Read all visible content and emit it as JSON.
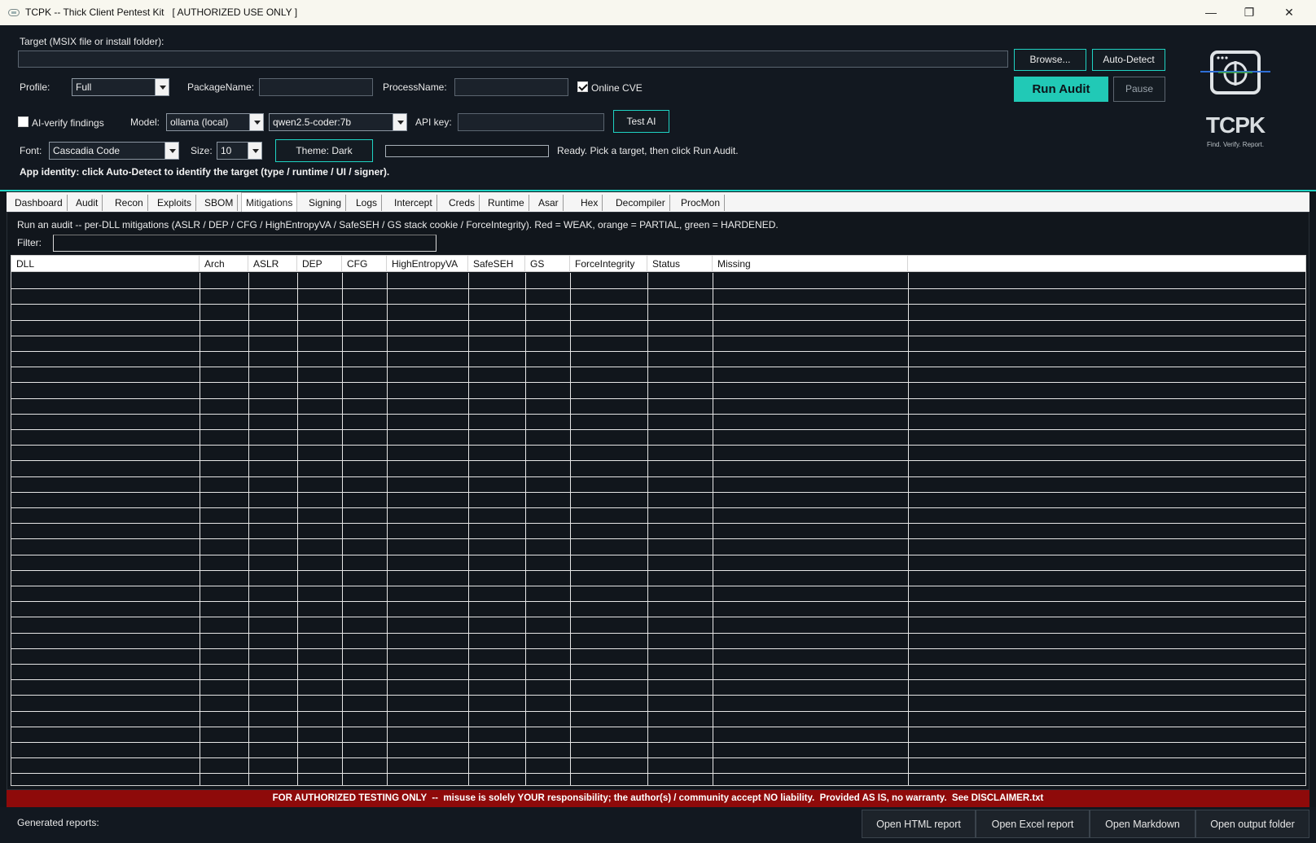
{
  "window": {
    "title": "TCPK -- Thick Client Pentest Kit   [ AUTHORIZED USE ONLY ]",
    "minimize": "—",
    "restore": "❐",
    "close": "✕"
  },
  "header": {
    "target_label": "Target (MSIX file or install folder):",
    "target_value": "",
    "browse_label": "Browse...",
    "autodetect_label": "Auto-Detect",
    "profile_label": "Profile:",
    "profile_value": "Full",
    "package_label": "PackageName:",
    "package_value": "",
    "process_label": "ProcessName:",
    "process_value": "",
    "online_cve_label": "Online CVE",
    "online_cve_checked": true,
    "run_audit_label": "Run Audit",
    "pause_label": "Pause",
    "ai_verify_label": "AI-verify findings",
    "ai_verify_checked": false,
    "model_label": "Model:",
    "model_value": "ollama (local)",
    "model_name_value": "qwen2.5-coder:7b",
    "api_key_label": "API key:",
    "api_key_value": "",
    "test_ai_label": "Test AI",
    "font_label": "Font:",
    "font_value": "Cascadia Code",
    "size_label": "Size:",
    "size_value": "10",
    "theme_label": "Theme: Dark",
    "status_text": "Ready. Pick a target, then click Run Audit.",
    "identity_text": "App identity: click Auto-Detect to identify the target (type / runtime / UI / signer).",
    "brand": "TCPK",
    "tagline": "Find. Verify. Report."
  },
  "tabs": [
    "Dashboard",
    "Audit",
    "Recon",
    "Exploits",
    "SBOM",
    "Mitigations",
    "Signing",
    "Logs",
    "Intercept",
    "Creds",
    "Runtime",
    "Asar",
    "Hex",
    "Decompiler",
    "ProcMon"
  ],
  "active_tab": "Mitigations",
  "mitigations": {
    "info": "Run an audit -- per-DLL mitigations (ASLR / DEP / CFG / HighEntropyVA / SafeSEH / GS stack cookie / ForceIntegrity). Red = WEAK, orange = PARTIAL, green = HARDENED.",
    "filter_label": "Filter:",
    "filter_value": "",
    "columns": [
      "DLL",
      "Arch",
      "ASLR",
      "DEP",
      "CFG",
      "HighEntropyVA",
      "SafeSEH",
      "GS",
      "ForceIntegrity",
      "Status",
      "Missing"
    ],
    "rows": []
  },
  "disclaimer": "FOR AUTHORIZED TESTING ONLY  --  misuse is solely YOUR responsibility; the author(s) / community accept NO liability.  Provided AS IS, no warranty.  See DISCLAIMER.txt",
  "footer": {
    "reports_label": "Generated reports:",
    "buttons": [
      "Open HTML report",
      "Open Excel report",
      "Open Markdown",
      "Open output folder"
    ]
  },
  "colors": {
    "accent": "#1fd3c3",
    "background": "#11161c",
    "disclaimer_bg": "#8e0a0a"
  }
}
